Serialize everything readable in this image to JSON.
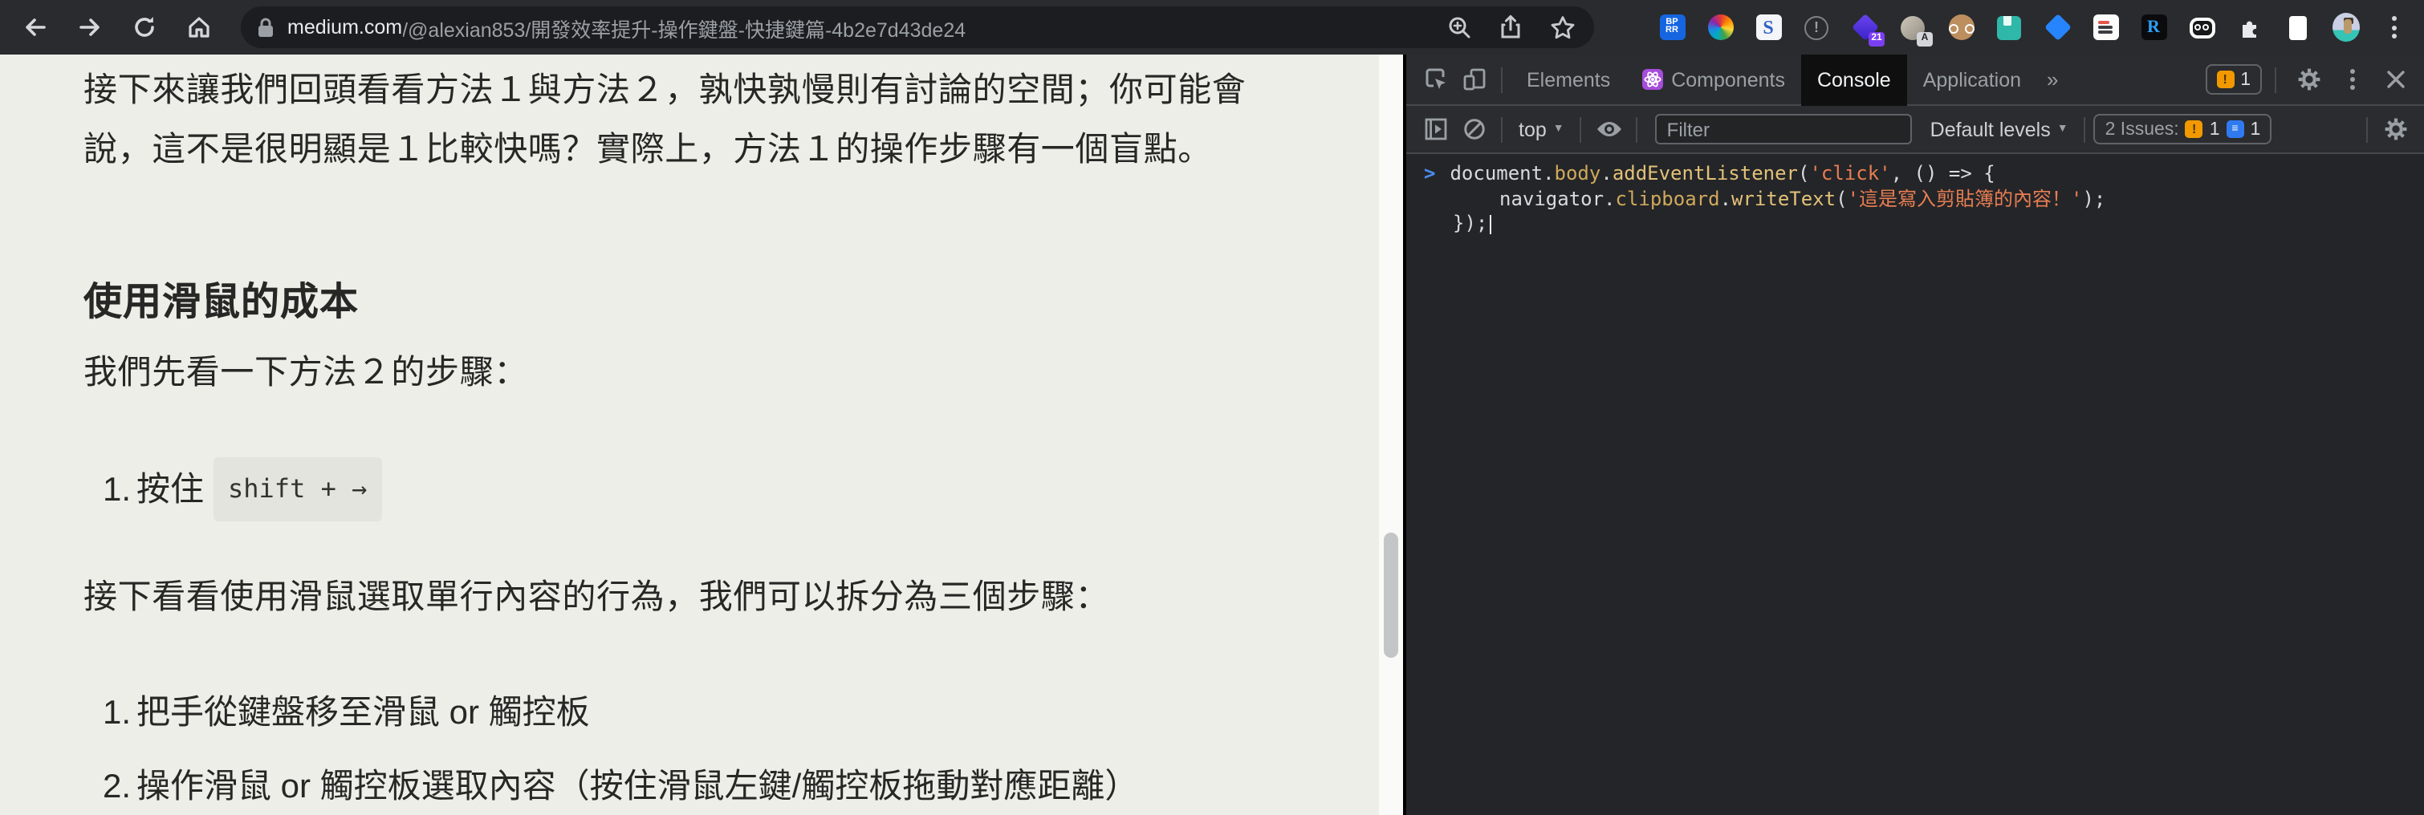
{
  "browser": {
    "url": {
      "host": "medium.com",
      "path": "/@alexian853/開發效率提升-操作鍵盤-快捷鍵篇-4b2e7d43de24"
    },
    "extensions": {
      "bprr_line1": "BP",
      "bprr_line2": "RR",
      "sider_label": "S",
      "excl_label": "!",
      "diamond_badge": "21",
      "keycap_badge": "A",
      "r_label": "R"
    }
  },
  "article": {
    "p1_line1": "接下來讓我們回頭看看方法１與方法２，孰快孰慢則有討論的空間；你可能會",
    "p1_line2": "說，這不是很明顯是１比較快嗎？實際上，方法１的操作步驟有一個盲點。",
    "heading": "使用滑鼠的成本",
    "p2": "我們先看一下方法２的步驟：",
    "list1": [
      {
        "num": "1.",
        "pre": "按住",
        "code": "shift + →"
      }
    ],
    "p3": "接下看看使用滑鼠選取單行內容的行為，我們可以拆分為三個步驟：",
    "list2": [
      {
        "num": "1.",
        "text": "把手從鍵盤移至滑鼠 or 觸控板"
      },
      {
        "num": "2.",
        "text": "操作滑鼠 or 觸控板選取內容（按住滑鼠左鍵/觸控板拖動對應距離）"
      }
    ]
  },
  "devtools": {
    "tabs": [
      {
        "label": "Elements"
      },
      {
        "label": "Components"
      },
      {
        "label": "Console"
      },
      {
        "label": "Application"
      }
    ],
    "more_symbol": "»",
    "tabbar_issue_count": "1",
    "toolbar": {
      "context": "top",
      "caret": "▼",
      "filter_placeholder": "Filter",
      "levels": "Default levels",
      "issues_label": "2 Issues:",
      "issue_error_count": "1",
      "issue_info_count": "1",
      "bubble_excl": "!",
      "bubble_lines": "≡"
    },
    "console": {
      "prompt": ">",
      "l1": {
        "a": "document.",
        "b": "body",
        "c": ".",
        "d": "addEventListener",
        "e": "(",
        "f": "'click'",
        "g": ", () => {"
      },
      "l2": {
        "a": "navigator.",
        "b": "clipboard",
        "c": ".",
        "d": "writeText",
        "e": "(",
        "f": "'這是寫入剪貼簿的內容！'",
        "g": ");"
      },
      "l3": "});"
    }
  },
  "colors": {
    "issue_orange": "#f29900",
    "issue_blue": "#2f7af0",
    "react_purple": "#a64ddb",
    "prompt_blue": "#4b8bf0",
    "string_orange": "#e87e52",
    "property_yellow": "#cfa95c",
    "article_bg": "#edeee8",
    "devtools_bg": "#242528"
  }
}
